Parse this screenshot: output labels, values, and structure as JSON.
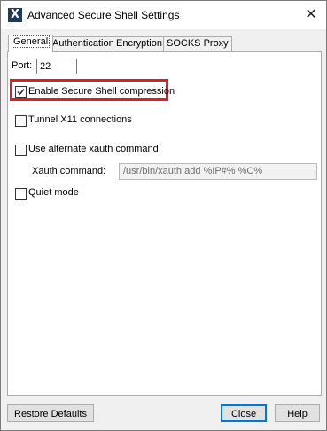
{
  "window": {
    "title": "Advanced Secure Shell Settings",
    "app_icon_letter": "X",
    "close_glyph": "✕"
  },
  "tabs": [
    {
      "label": "General",
      "active": true
    },
    {
      "label": "Authentication",
      "active": false
    },
    {
      "label": "Encryption",
      "active": false
    },
    {
      "label": "SOCKS Proxy",
      "active": false
    }
  ],
  "general": {
    "port_label": "Port:",
    "port_value": "22",
    "compression_label": "Enable Secure Shell compression",
    "compression_checked": true,
    "tunnel_x11_label": "Tunnel X11 connections",
    "tunnel_x11_checked": false,
    "alt_xauth_label": "Use alternate xauth command",
    "alt_xauth_checked": false,
    "xauth_command_label": "Xauth command:",
    "xauth_command_value": "/usr/bin/xauth add %IP#% %C%",
    "quiet_mode_label": "Quiet mode",
    "quiet_mode_checked": false
  },
  "buttons": {
    "restore_defaults": "Restore Defaults",
    "close": "Close",
    "help": "Help"
  },
  "colors": {
    "highlight": "#e01c24",
    "default_button_border": "#0078d7",
    "app_icon_bg": "#1e3a5f"
  }
}
